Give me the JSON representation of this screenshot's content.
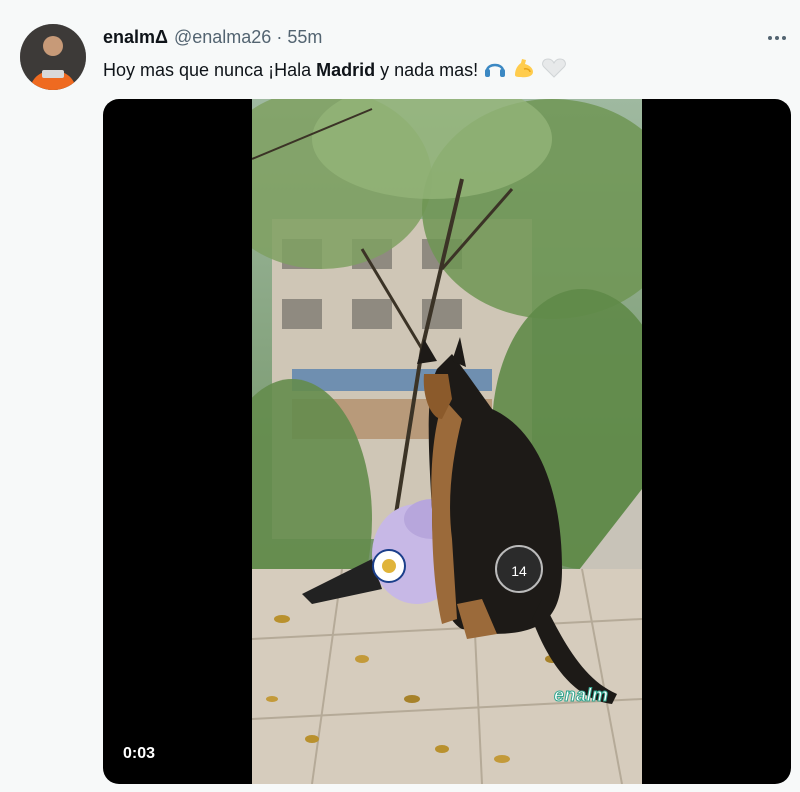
{
  "tweet": {
    "display_name": "enalmΔ",
    "handle": "@enalma26",
    "separator": "·",
    "time": "55m",
    "text_before": "Hoy mas que nunca ¡Hala ",
    "text_bold": "Madrid",
    "text_after": " y nada mas!",
    "emojis": [
      "headphones-emoji",
      "flexed-biceps-emoji",
      "white-heart-emoji"
    ]
  },
  "media": {
    "duration": "0:03",
    "watermark": "enalm",
    "badge_number": "14"
  },
  "colors": {
    "background": "#f7f9f9",
    "text_primary": "#0f1419",
    "text_secondary": "#536471",
    "video_letterbox": "#000000",
    "watermark_accent": "#2fa58e"
  }
}
